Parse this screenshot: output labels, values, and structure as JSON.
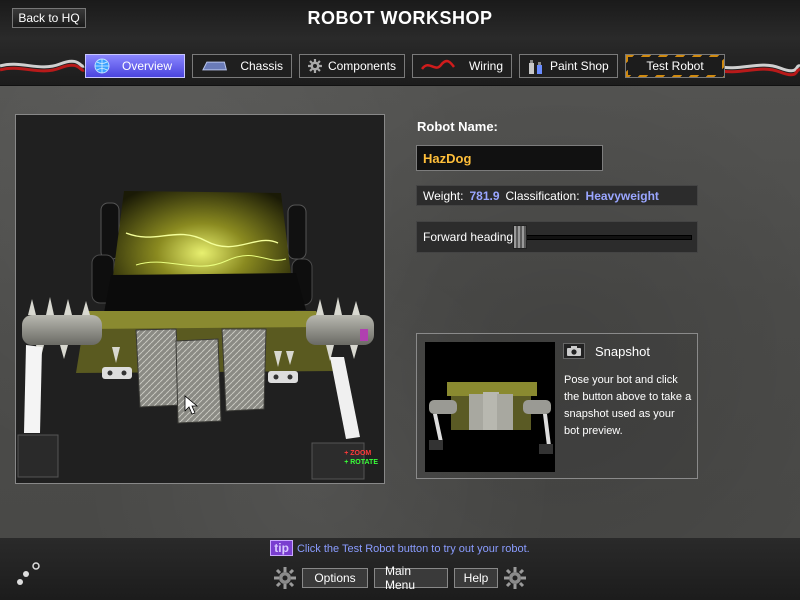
{
  "header": {
    "back_label": "Back to HQ",
    "title": "ROBOT WORKSHOP"
  },
  "tabs": [
    {
      "label": "Overview",
      "icon": "globe-icon",
      "active": true
    },
    {
      "label": "Chassis",
      "icon": "chassis-icon",
      "active": false
    },
    {
      "label": "Components",
      "icon": "gear-icon",
      "active": false
    },
    {
      "label": "Wiring",
      "icon": "wire-icon",
      "active": false
    },
    {
      "label": "Paint Shop",
      "icon": "paint-icon",
      "active": false
    },
    {
      "label": "Test Robot",
      "icon": "",
      "active": false
    }
  ],
  "viewport": {
    "hint_zoom": "ZOOM",
    "hint_rotate": "ROTATE"
  },
  "robot": {
    "name_label": "Robot Name:",
    "name_value": "HazDog",
    "weight_label": "Weight:",
    "weight_value": "781.9",
    "class_label": "Classification:",
    "class_value": "Heavyweight",
    "heading_label": "Forward heading:",
    "heading_position": 0.0
  },
  "snapshot": {
    "title": "Snapshot",
    "description": "Pose your bot and click the button above to take a snapshot used as your bot preview."
  },
  "footer": {
    "tip_badge": "tip",
    "tip_text": "Click the Test Robot button to try out your robot.",
    "options_label": "Options",
    "main_menu_label": "Main Menu",
    "help_label": "Help"
  },
  "colors": {
    "accent_name": "#ffbf3a",
    "stat_value": "#9aa6ff",
    "active_tab": "#5f58ee",
    "tip_text": "#8a9cff"
  }
}
